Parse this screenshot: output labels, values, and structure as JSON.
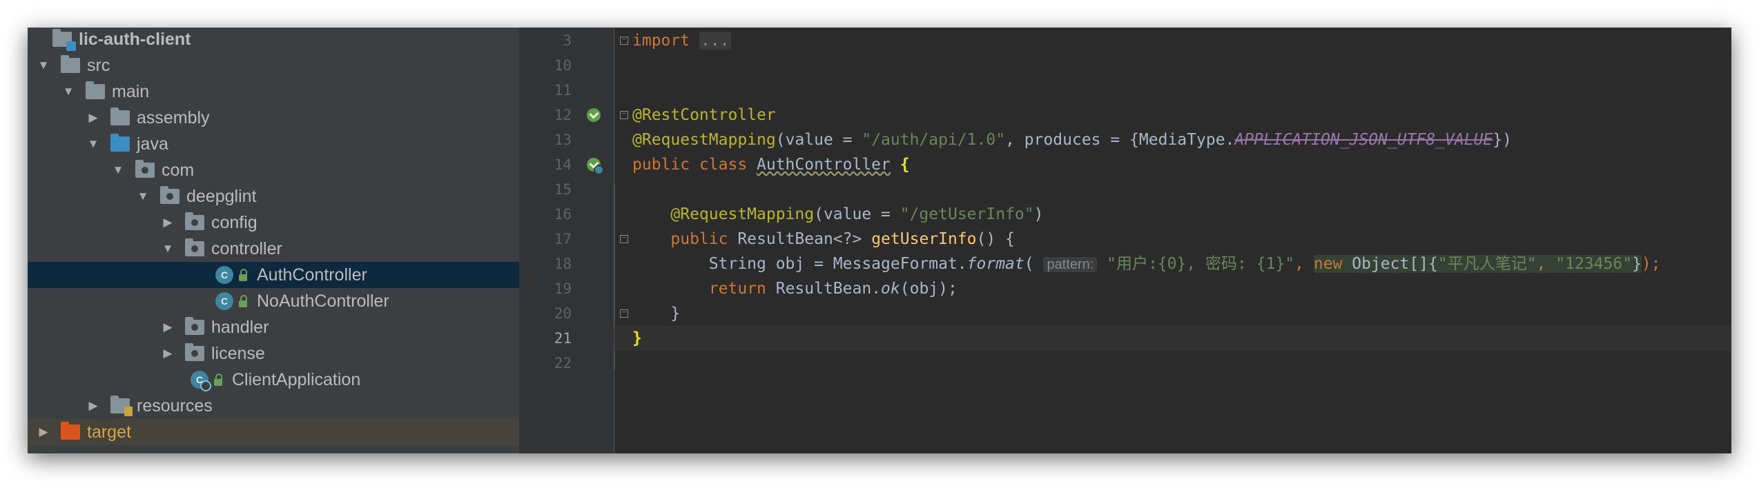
{
  "project_tree": {
    "root": "lic-auth-client",
    "items": {
      "src": "src",
      "main": "main",
      "assembly": "assembly",
      "java": "java",
      "com": "com",
      "deepglint": "deepglint",
      "config": "config",
      "controller": "controller",
      "auth_controller": "AuthController",
      "noauth_controller": "NoAuthController",
      "handler": "handler",
      "license": "license",
      "client_application": "ClientApplication",
      "resources": "resources",
      "target": "target"
    },
    "class_icon_letter": "C"
  },
  "editor": {
    "line_numbers": [
      "3",
      "10",
      "11",
      "12",
      "13",
      "14",
      "15",
      "16",
      "17",
      "18",
      "19",
      "20",
      "21",
      "22"
    ],
    "current_line": "21",
    "code": {
      "l3_kw": "import",
      "l3_folded": "...",
      "l12_ann": "@RestController",
      "l13_ann": "@RequestMapping",
      "l13_p1": "(value = ",
      "l13_str": "\"/auth/api/1.0\"",
      "l13_p2": ", produces = {MediaType.",
      "l13_const": "APPLICATION_JSON_UTF8_VALUE",
      "l13_p3": "})",
      "l14_kw": "public class ",
      "l14_name": "AuthController",
      "l14_brace": "{",
      "l16_indent": "    ",
      "l16_ann": "@RequestMapping",
      "l16_p1": "(value = ",
      "l16_str": "\"/getUserInfo\"",
      "l16_p2": ")",
      "l17_indent": "    ",
      "l17_kw": "public ",
      "l17_type": "ResultBean<?> ",
      "l17_fn": "getUserInfo",
      "l17_rest": "() {",
      "l18_indent": "        ",
      "l18_p1": "String obj = MessageFormat.",
      "l18_fn": "format",
      "l18_p2": "( ",
      "l18_hint": "pattern:",
      "l18_str1": " \"用户:{0}, 密码: {1}\"",
      "l18_comma": ", ",
      "l18_new": "new ",
      "l18_obj": "Object[]{",
      "l18_str2": "\"平凡人笔记\"",
      "l18_sep": ", ",
      "l18_str3": "\"123456\"",
      "l18_close": "}",
      "l18_end": ");",
      "l19_indent": "        ",
      "l19_kw": "return ",
      "l19_p1": "ResultBean.",
      "l19_fn": "ok",
      "l19_p2": "(obj);",
      "l20_text": "    }",
      "l21_brace": "}"
    }
  },
  "colors": {
    "background": "#2b2b2b",
    "tree_background": "#3c3f41",
    "selection": "#0d293e",
    "keyword": "#cc7832",
    "annotation": "#bbb529",
    "string": "#6a8759",
    "method": "#ffc66d",
    "constant": "#9876aa"
  },
  "icons": {
    "folder": "folder-icon",
    "class": "class-icon",
    "lock": "lock-icon",
    "spring_bean": "spring-bean-icon",
    "fold": "fold-icon"
  }
}
